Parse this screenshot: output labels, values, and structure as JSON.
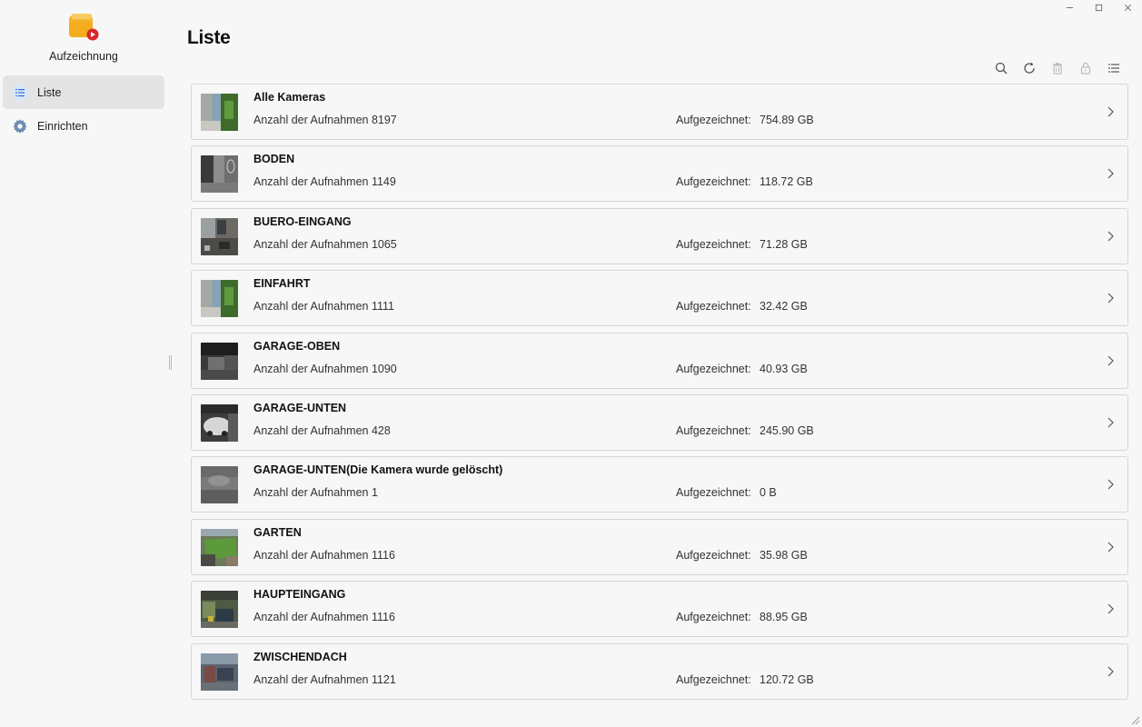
{
  "app": {
    "title": "Aufzeichnung",
    "accent": "#f5b731",
    "badge_color": "#d9262c"
  },
  "window_controls": {
    "minimize": "–",
    "maximize": "□",
    "close": "✕"
  },
  "sidebar": {
    "items": [
      {
        "label": "Liste",
        "icon": "list-icon",
        "active": true
      },
      {
        "label": "Einrichten",
        "icon": "gear-icon",
        "active": false
      }
    ]
  },
  "main": {
    "title": "Liste",
    "toolbar": [
      "search-icon",
      "refresh-icon",
      "trash-icon",
      "lock-icon",
      "menu-icon"
    ],
    "cameras": [
      {
        "name": "Alle Kameras",
        "count_text": "Anzahl der Aufnahmen 8197",
        "rec_label": "Aufgezeichnet:",
        "rec_value": "754.89 GB"
      },
      {
        "name": "BODEN",
        "count_text": "Anzahl der Aufnahmen 1149",
        "rec_label": "Aufgezeichnet:",
        "rec_value": "118.72 GB"
      },
      {
        "name": "BUERO-EINGANG",
        "count_text": "Anzahl der Aufnahmen 1065",
        "rec_label": "Aufgezeichnet:",
        "rec_value": "71.28 GB"
      },
      {
        "name": "EINFAHRT",
        "count_text": "Anzahl der Aufnahmen 1111",
        "rec_label": "Aufgezeichnet:",
        "rec_value": "32.42 GB"
      },
      {
        "name": "GARAGE-OBEN",
        "count_text": "Anzahl der Aufnahmen 1090",
        "rec_label": "Aufgezeichnet:",
        "rec_value": "40.93 GB"
      },
      {
        "name": "GARAGE-UNTEN",
        "count_text": "Anzahl der Aufnahmen 428",
        "rec_label": "Aufgezeichnet:",
        "rec_value": "245.90 GB"
      },
      {
        "name": "GARAGE-UNTEN(Die Kamera wurde gelöscht)",
        "count_text": "Anzahl der Aufnahmen 1",
        "rec_label": "Aufgezeichnet:",
        "rec_value": "0 B"
      },
      {
        "name": "GARTEN",
        "count_text": "Anzahl der Aufnahmen 1116",
        "rec_label": "Aufgezeichnet:",
        "rec_value": "35.98 GB"
      },
      {
        "name": "HAUPTEINGANG",
        "count_text": "Anzahl der Aufnahmen 1116",
        "rec_label": "Aufgezeichnet:",
        "rec_value": "88.95 GB"
      },
      {
        "name": "ZWISCHENDACH",
        "count_text": "Anzahl der Aufnahmen 1121",
        "rec_label": "Aufgezeichnet:",
        "rec_value": "120.72 GB"
      }
    ]
  }
}
